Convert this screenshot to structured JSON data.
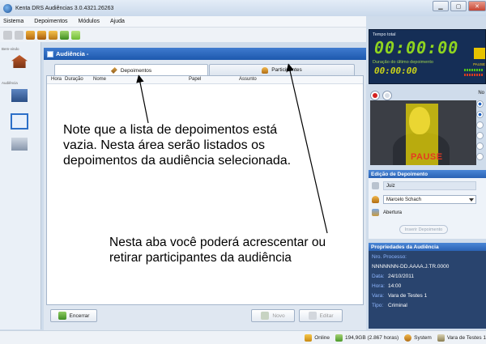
{
  "window": {
    "title": "Kenta DRS Audiências 3.0.4321.26263",
    "controls": [
      "minimize",
      "maximize",
      "close"
    ]
  },
  "menu": [
    "Sistema",
    "Depoimentos",
    "Módulos",
    "Ajuda"
  ],
  "sidebar": {
    "labels": [
      "Bem-vindo",
      "Audiência"
    ]
  },
  "main": {
    "header_title": "Audiência -",
    "tabs": [
      {
        "label": "Depoimentos",
        "icon": "key-icon"
      },
      {
        "label": "Participantes",
        "icon": "person-icon"
      }
    ],
    "columns": [
      "Hora",
      "Duração",
      "Nome",
      "Papel",
      "Assunto"
    ],
    "buttons": {
      "encerrar": "Encerrar",
      "novo": "Novo",
      "editar": "Editar"
    }
  },
  "recorder": {
    "tempo_total_label": "Tempo total",
    "tempo_total": "00:00:00",
    "duracao_label": "Duração do último depoimento",
    "duracao": "00:00:00",
    "pause_tag": "PAUSE",
    "no_label": "No",
    "video_overlay": "PAUSE"
  },
  "edicao": {
    "header": "Edição de Depoimento",
    "papel": "Juiz",
    "nome": "Marcelo Schach",
    "assunto": "Abertura",
    "insert_button": "Inserir Depoimento"
  },
  "propriedades": {
    "header": "Propriedades da Audiência",
    "processo_label": "Nro. Processo:",
    "processo": "NNNNNNN-DD.AAAA.J.TR.0000",
    "data_label": "Data:",
    "data": "24/10/2011",
    "hora_label": "Hora:",
    "hora": "14:00",
    "vara_label": "Vara:",
    "vara": "Vara de Testes 1",
    "tipo_label": "Tipo:",
    "tipo": "Criminal"
  },
  "status": {
    "online": "Online",
    "disk": "194,9GB (2.867 horas)",
    "user": "System",
    "vara": "Vara de Testes 1"
  },
  "annotations": {
    "note_1": "Note que a lista de depoimentos está vazia. Nesta área serão listados os depoimentos da audiência selecionada.",
    "note_2": "Nesta aba você poderá acrescentar ou retirar participantes da audiência"
  }
}
